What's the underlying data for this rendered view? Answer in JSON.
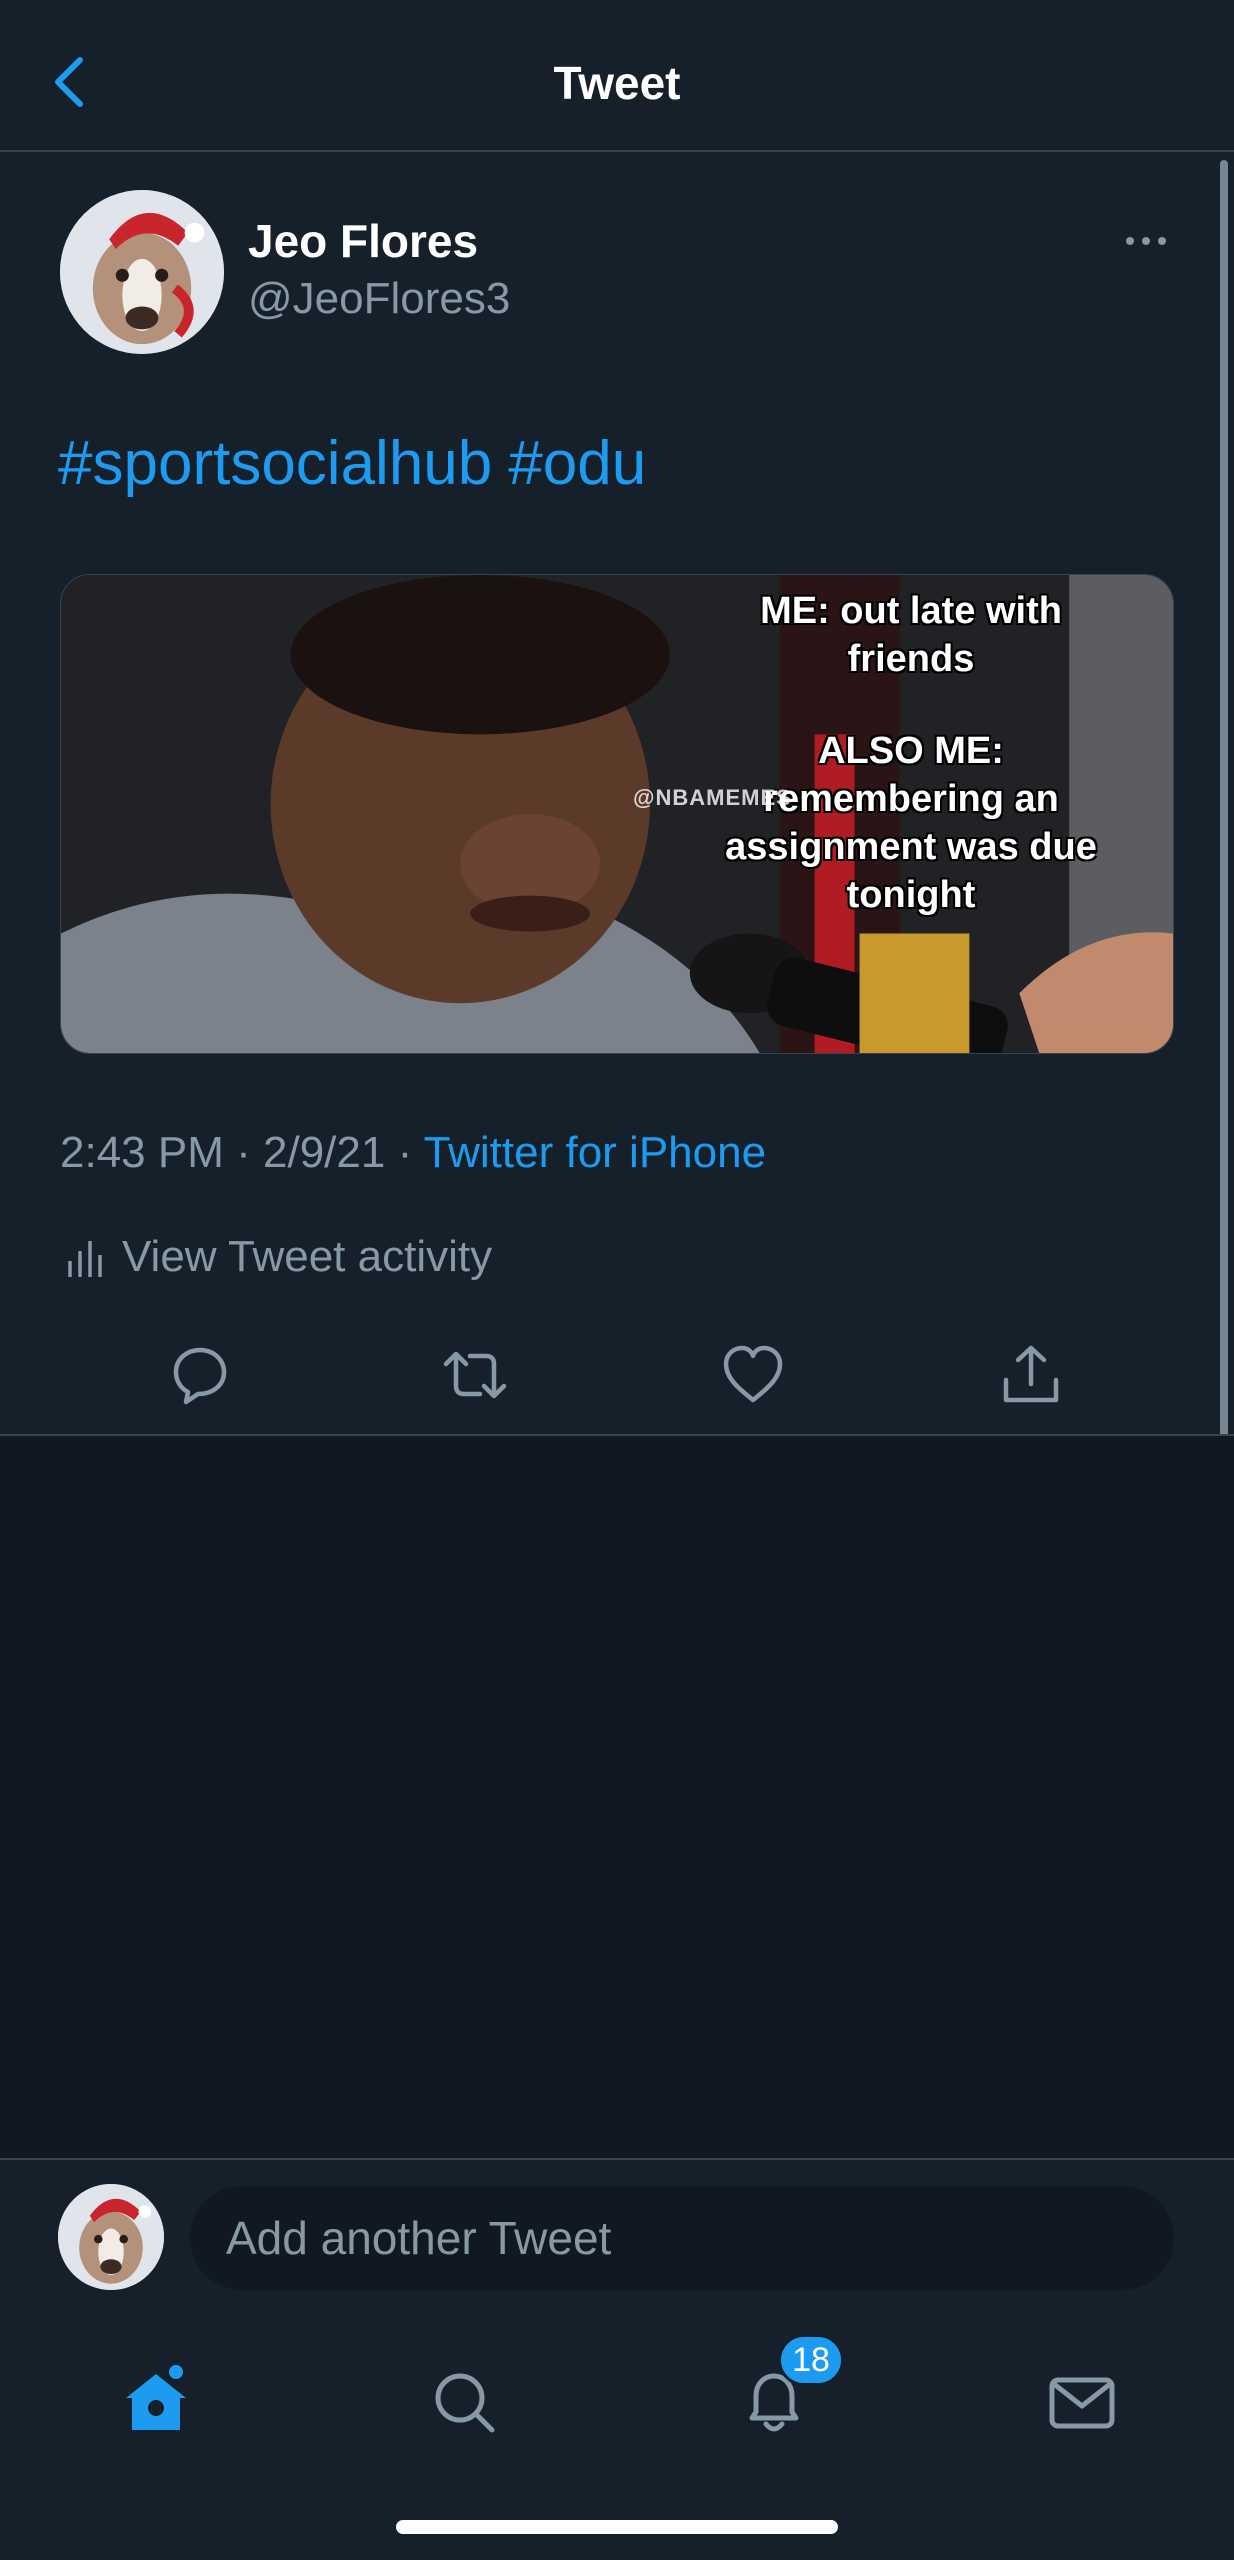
{
  "header": {
    "title": "Tweet"
  },
  "tweet": {
    "author_name": "Jeo Flores",
    "author_handle": "@JeoFlores3",
    "hashtags": [
      "#sportsocialhub",
      "#odu"
    ],
    "media": {
      "caption_lines_top": [
        "ME: out late with",
        "friends"
      ],
      "caption_lines_bottom": [
        "ALSO ME:",
        "remembering an",
        "assignment was due",
        "tonight"
      ],
      "watermark": "@NBAMEMES"
    },
    "time": "2:43 PM",
    "date": "2/9/21",
    "separator": "·",
    "source": "Twitter for iPhone",
    "activity_label": "View Tweet activity"
  },
  "compose": {
    "placeholder": "Add another Tweet"
  },
  "tabbar": {
    "notifications_badge": "18"
  },
  "colors": {
    "background": "#15202b",
    "accent": "#1d9bf0",
    "secondary_text": "#8899a6",
    "border": "#38444d"
  }
}
